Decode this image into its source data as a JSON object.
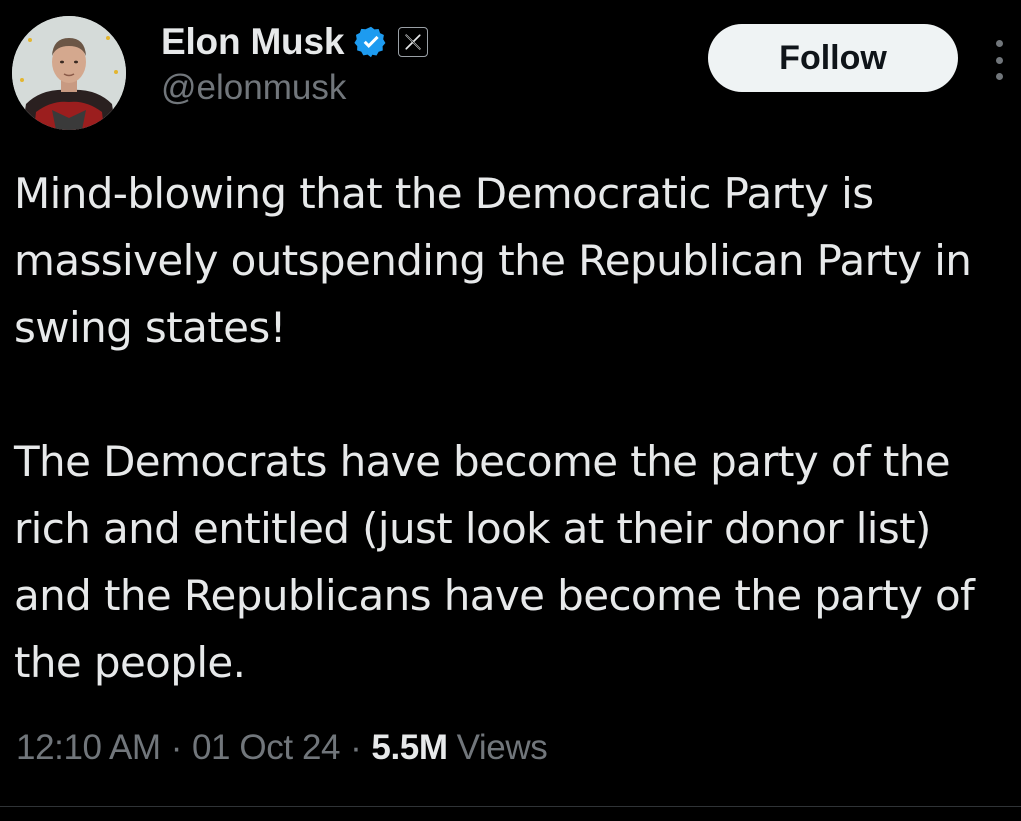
{
  "author": {
    "display_name": "Elon Musk",
    "handle": "@elonmusk",
    "verified_icon": "verified-badge-icon",
    "affiliation_icon": "x-logo-icon"
  },
  "actions": {
    "follow_label": "Follow",
    "more_icon": "more-options-icon"
  },
  "tweet": {
    "paragraphs": [
      "Mind-blowing that the Democratic Party is massively outspending the Republican Party in swing states!",
      "The Democrats have become the party of the rich and entitled (just look at their donor list) and the Republicans have become the party of the people."
    ]
  },
  "meta": {
    "time": "12:10 AM",
    "date": "01 Oct 24",
    "separator": "·",
    "views_count": "5.5M",
    "views_label": "Views"
  },
  "colors": {
    "background": "#000000",
    "primary_text": "#e7e9ea",
    "secondary_text": "#71767b",
    "verified_blue": "#1d9bf0",
    "follow_button_bg": "#eff3f4",
    "divider": "#2f3336"
  }
}
